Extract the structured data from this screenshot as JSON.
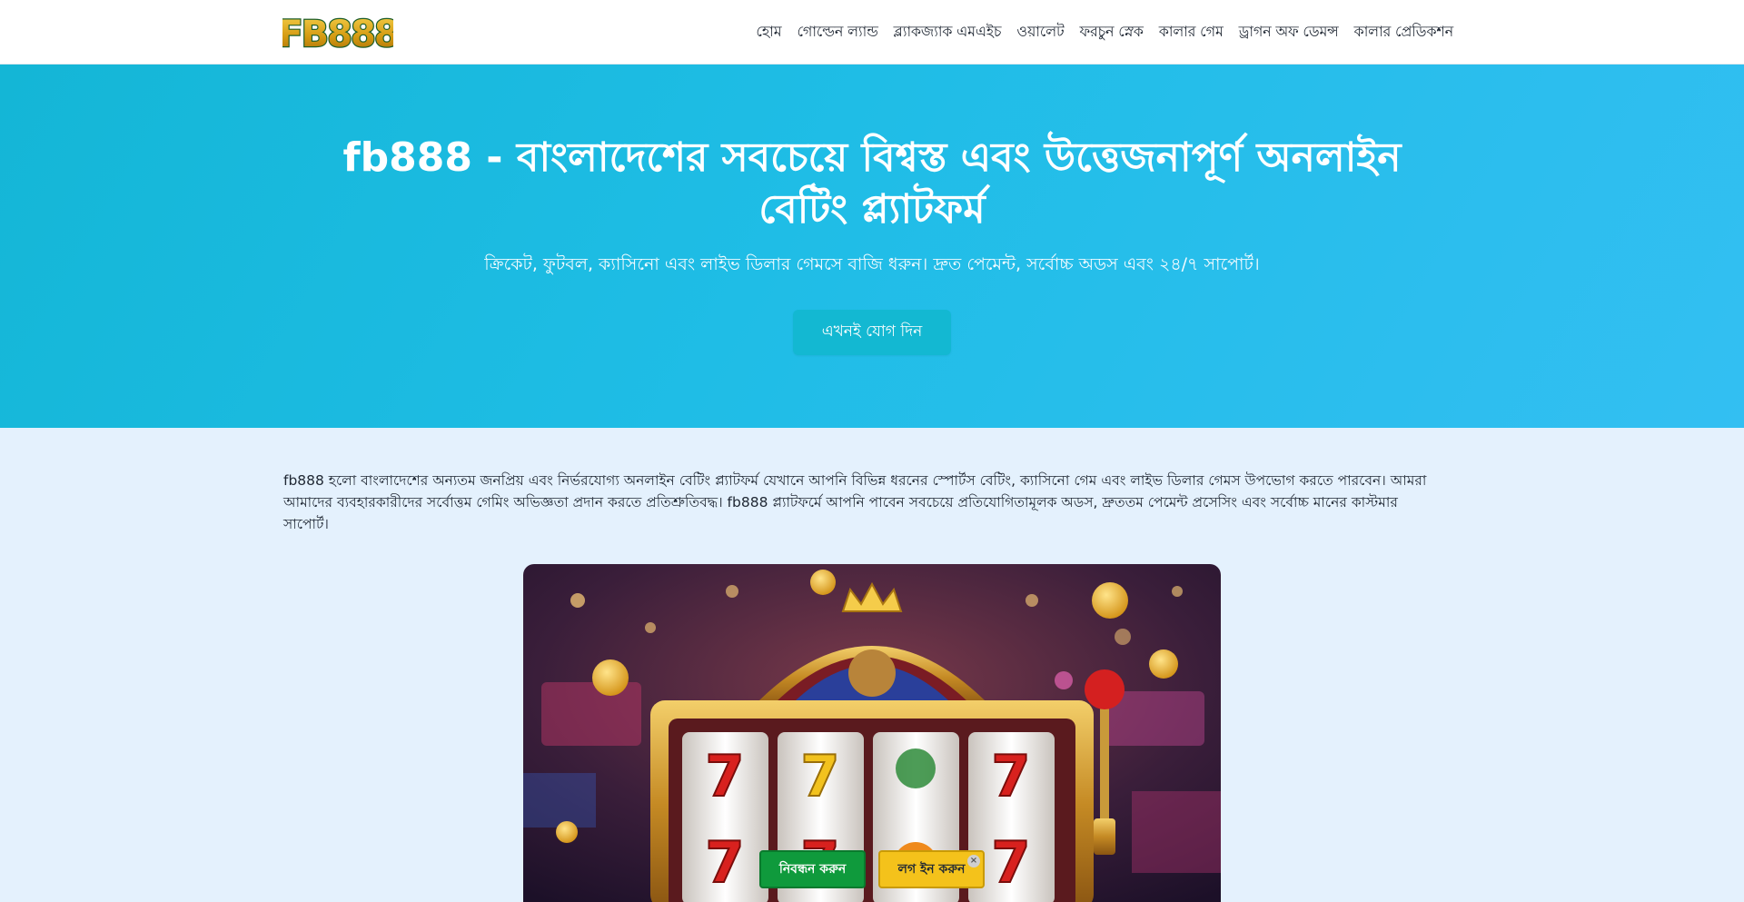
{
  "brand": {
    "logo_text": "FB888"
  },
  "nav": {
    "items": [
      "হোম",
      "গোল্ডেন ল্যান্ড",
      "ব্ল্যাকজ্যাক এমএইচ",
      "ওয়ালেট",
      "ফরচুন স্নেক",
      "কালার গেম",
      "ড্রাগন অফ ডেমন্স",
      "কালার প্রেডিকশন"
    ]
  },
  "hero": {
    "title_line1": "fb888 - বাংলাদেশের সবচেয়ে বিশ্বস্ত এবং উত্তেজনাপূর্ণ অনলাইন",
    "title_line2": "বেটিং প্ল্যাটফর্ম",
    "subtitle": "ক্রিকেট, ফুটবল, ক্যাসিনো এবং লাইভ ডিলার গেমসে বাজি ধরুন। দ্রুত পেমেন্ট, সর্বোচ্চ অডস এবং ২৪/৭ সাপোর্ট।",
    "cta_label": "এখনই যোগ দিন"
  },
  "intro": {
    "text": "fb888 হলো বাংলাদেশের অন্যতম জনপ্রিয় এবং নির্ভরযোগ্য অনলাইন বেটিং প্ল্যাটফর্ম যেখানে আপনি বিভিন্ন ধরনের স্পোর্টস বেটিং, ক্যাসিনো গেম এবং লাইভ ডিলার গেমস উপভোগ করতে পারবেন। আমরা আমাদের ব্যবহারকারীদের সর্বোত্তম গেমিং অভিজ্ঞতা প্রদান করতে প্রতিশ্রুতিবদ্ধ। fb888 প্ল্যাটফর্মে আপনি পাবেন সবচেয়ে প্রতিযোগিতামূলক অডস, দ্রুততম পেমেন্ট প্রসেসিং এবং সর্বোচ্চ মানের কাস্টমার সাপোর্ট।"
  },
  "banner": {
    "reel_symbol": "7"
  },
  "floating": {
    "register_label": "নিবন্ধন করুন",
    "login_label": "লগ ইন করুন",
    "close_symbol": "×"
  },
  "colors": {
    "hero_start": "#14b6d6",
    "hero_end": "#33bff2",
    "cta": "#13b8d2",
    "register": "#0f9a3c",
    "login": "#f4c21b",
    "page_bg": "#e4f1fd"
  }
}
